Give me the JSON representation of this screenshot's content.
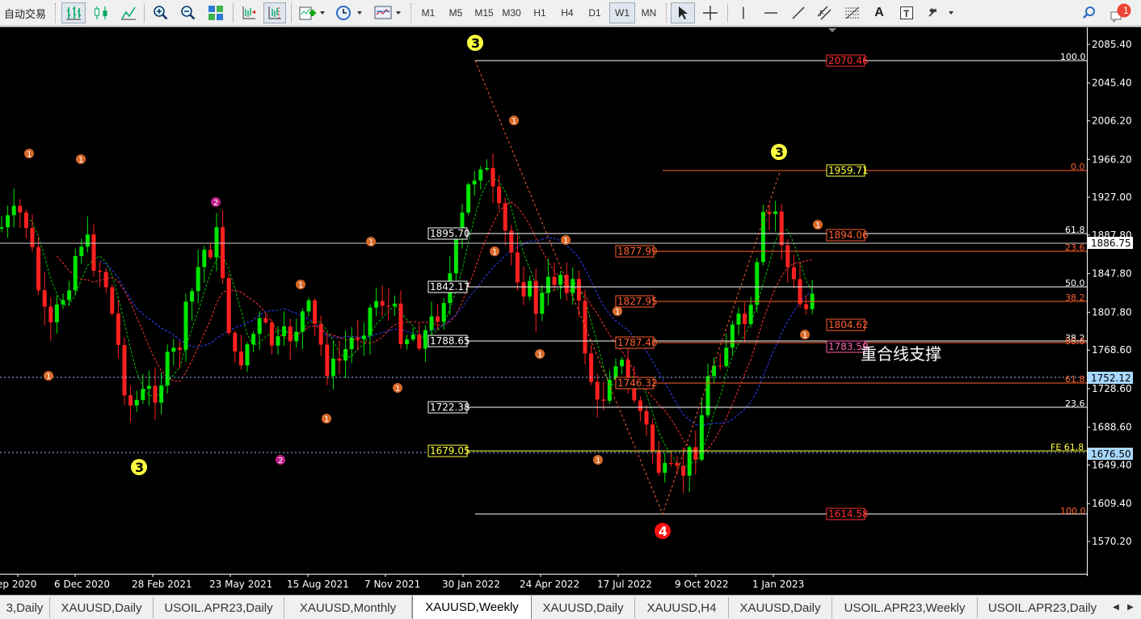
{
  "toolbar": {
    "auto_trading_label": "自动交易",
    "timeframes": [
      "M1",
      "M5",
      "M15",
      "M30",
      "H1",
      "H4",
      "D1",
      "W1",
      "MN"
    ],
    "active_timeframe": "W1",
    "notification_count": "1",
    "tools": {
      "vertical_line": "|",
      "text": "A",
      "text_label": "T"
    }
  },
  "chart": {
    "symbol_timeframe": "XAUUSD,Weekly",
    "current_price": "1886.75",
    "price_scale": [
      "2085.40",
      "2045.40",
      "2006.20",
      "1966.20",
      "1927.00",
      "1887.80",
      "1847.80",
      "1807.80",
      "1768.60",
      "1728.60",
      "1688.60",
      "1649.40",
      "1609.40",
      "1570.20"
    ],
    "highlighted_prices": [
      {
        "value": "1752.12",
        "color": "#a8d8ff"
      },
      {
        "value": "1676.50",
        "color": "#a8d8ff"
      }
    ],
    "time_scale": [
      "ep 2020",
      "6 Dec 2020",
      "28 Feb 2021",
      "23 May 2021",
      "15 Aug 2021",
      "7 Nov 2021",
      "30 Jan 2022",
      "24 Apr 2022",
      "17 Jul 2022",
      "9 Oct 2022",
      "1 Jan 2023"
    ],
    "annotation_text": "重合线支撑",
    "level_boxes": [
      {
        "label": "1895.70",
        "style": "white"
      },
      {
        "label": "1842.17",
        "style": "white"
      },
      {
        "label": "1788.65",
        "style": "white"
      },
      {
        "label": "1722.38",
        "style": "white"
      },
      {
        "label": "1679.05",
        "style": "yellow"
      }
    ],
    "fib_right_labels": [
      "100.0",
      "0.0",
      "61.8",
      "23.6",
      "50.0",
      "38.2",
      "38.2",
      "50.0",
      "61.8",
      "23.6",
      "FE 61.8",
      "100.0"
    ],
    "fib_mid_labels": [
      "2070.46",
      "1959.71",
      "1894.06",
      "1877.99",
      "1827.95",
      "1804.62",
      "1787.40",
      "1783.59",
      "1746.32",
      "1614.58"
    ],
    "wave_labels": {
      "big_yellow": "3",
      "big_red": "4",
      "minor_one": "1",
      "minor_two": "2"
    }
  },
  "tabs": [
    {
      "label": "3,Daily",
      "active": false
    },
    {
      "label": "XAUUSD,Daily",
      "active": false
    },
    {
      "label": "USOIL.APR23,Daily",
      "active": false
    },
    {
      "label": "XAUUSD,Monthly",
      "active": false
    },
    {
      "label": "XAUUSD,Weekly",
      "active": true
    },
    {
      "label": "XAUUSD,Daily",
      "active": false
    },
    {
      "label": "XAUUSD,H4",
      "active": false
    },
    {
      "label": "XAUUSD,Daily",
      "active": false
    },
    {
      "label": "USOIL.APR23,Weekly",
      "active": false
    },
    {
      "label": "USOIL.APR23,Daily",
      "active": false
    }
  ],
  "colors": {
    "bull_candle": "#00e600",
    "bear_candle": "#ff2020",
    "fib_line": "#ff6030",
    "white_line": "#ffffff",
    "yellow_line": "#ffff40",
    "ma_green": "#00c000",
    "ma_red": "#ff3030",
    "ma_blue": "#3040ff"
  }
}
